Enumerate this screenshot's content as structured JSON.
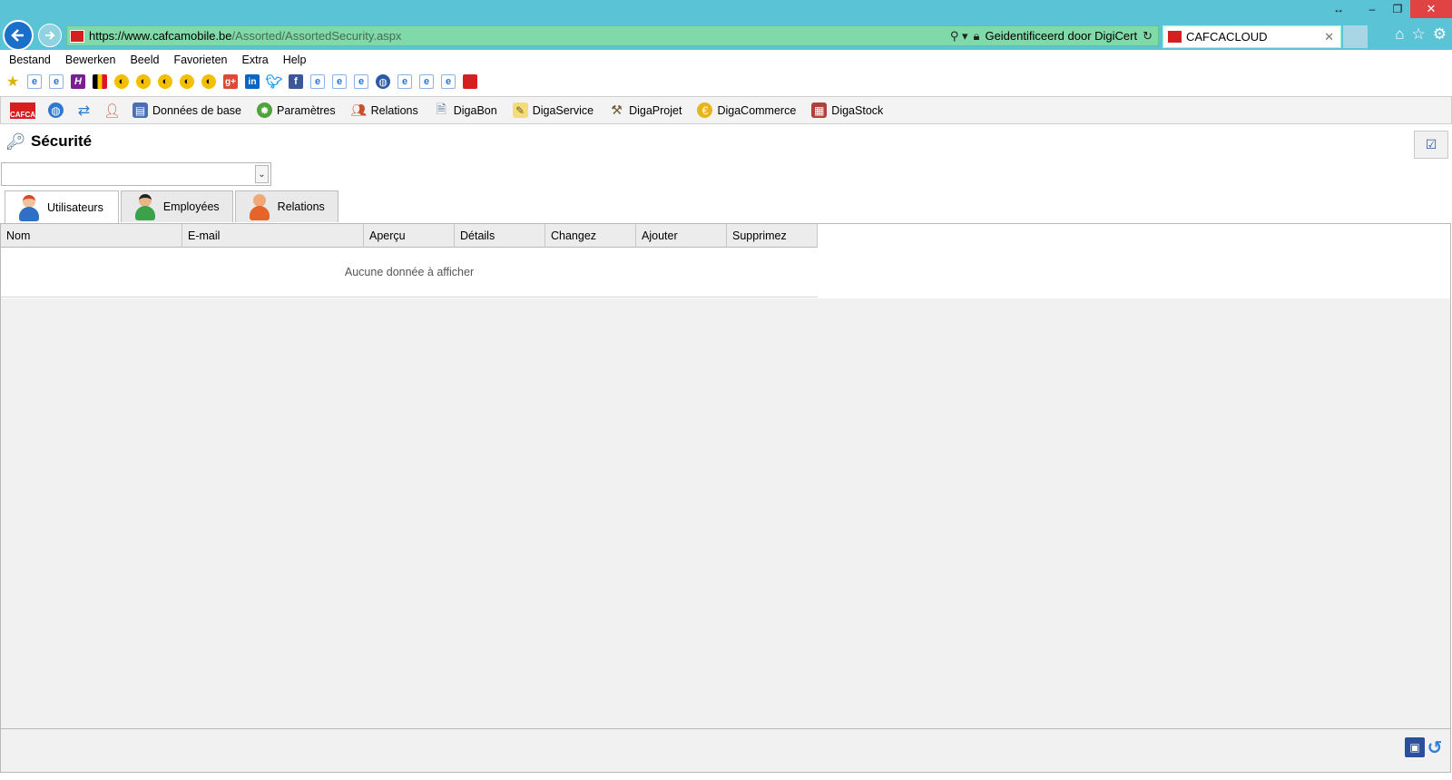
{
  "browser": {
    "url_host": "https://www.cafcamobile.be",
    "url_path": "/Assorted/AssortedSecurity.aspx",
    "cert_text": "Geidentificeerd door DigiCert",
    "tab_title": "CAFCACLOUD",
    "window_controls": {
      "resize": "↔",
      "minimize": "–",
      "restore": "❐",
      "close": "✕"
    }
  },
  "menu": [
    "Bestand",
    "Bewerken",
    "Beeld",
    "Favorieten",
    "Extra",
    "Help"
  ],
  "favorites": [
    "star-icon",
    "ie-icon",
    "ie-icon",
    "h-icon",
    "flag-icon",
    "radio-icon",
    "radio-icon",
    "radio-icon",
    "radio-icon",
    "radio-icon",
    "gplus-icon",
    "linkedin-icon",
    "twitter-icon",
    "facebook-icon",
    "ie-icon",
    "ie-icon",
    "ie-icon",
    "globe-icon",
    "ie-icon",
    "ie-icon",
    "ie-icon",
    "cafca-icon"
  ],
  "app_toolbar": {
    "logo_text": "CAFCA",
    "items": [
      {
        "label": "Données de base"
      },
      {
        "label": "Paramètres"
      },
      {
        "label": "Relations"
      },
      {
        "label": "DigaBon"
      },
      {
        "label": "DigaService"
      },
      {
        "label": "DigaProjet"
      },
      {
        "label": "DigaCommerce"
      },
      {
        "label": "DigaStock"
      }
    ]
  },
  "page": {
    "title": "Sécurité",
    "combo_value": ""
  },
  "tabs": [
    {
      "label": "Utilisateurs",
      "active": true,
      "color": "#d9472b"
    },
    {
      "label": "Employées",
      "active": false,
      "color": "#3aa34a"
    },
    {
      "label": "Relations",
      "active": false,
      "color": "#e4642a"
    }
  ],
  "grid": {
    "columns": [
      "Nom",
      "E-mail",
      "Aperçu",
      "Détails",
      "Changez",
      "Ajouter",
      "Supprimez"
    ],
    "empty_text": "Aucune donnée à afficher"
  },
  "colors": {
    "titlebar": "#5bc3d6",
    "addressbar": "#80d9a8",
    "brand_red": "#d42020"
  }
}
